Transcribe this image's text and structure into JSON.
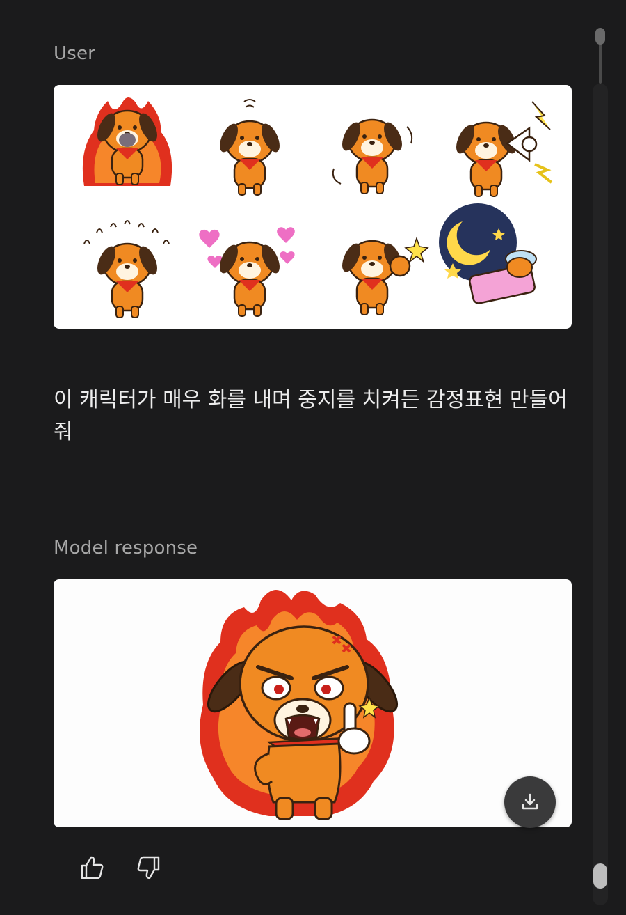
{
  "user_section": {
    "label": "User",
    "sticker_sheet": {
      "stickers": [
        {
          "icon": "angry-dog-in-flames"
        },
        {
          "icon": "sad-dog-drooping"
        },
        {
          "icon": "excited-dog-waving"
        },
        {
          "icon": "dog-shouting-megaphone"
        },
        {
          "icon": "anxious-dog-praying"
        },
        {
          "icon": "dog-with-hearts"
        },
        {
          "icon": "dog-punching-sparkle"
        },
        {
          "icon": "dog-sleeping-under-moon"
        }
      ]
    },
    "prompt": "이 캐릭터가 매우 화를 내며 중지를 치켜든 감정표현 만들어 줘"
  },
  "model_section": {
    "label": "Model response",
    "image": {
      "icon": "angry-dog-middle-finger-flames"
    },
    "download_icon": "download-icon"
  },
  "feedback": {
    "thumbs_up_icon": "thumbs-up-icon",
    "thumbs_down_icon": "thumbs-down-icon"
  },
  "colors": {
    "background": "#1b1b1c",
    "dog_orange": "#f08a22",
    "flame_red": "#e0301e",
    "flame_orange": "#f6862a"
  }
}
